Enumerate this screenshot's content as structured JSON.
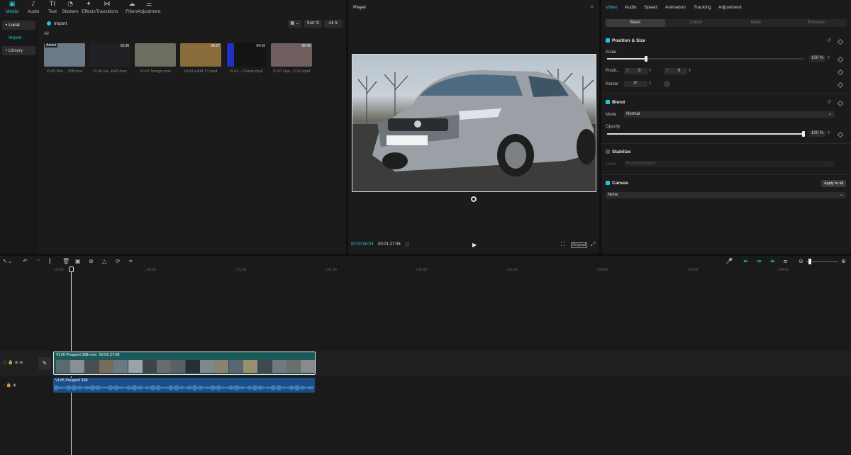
{
  "toolbar": {
    "items": [
      {
        "label": "Media",
        "icon": "media-icon",
        "glyph": "▣",
        "active": true
      },
      {
        "label": "Audio",
        "icon": "audio-icon",
        "glyph": "♪"
      },
      {
        "label": "Text",
        "icon": "text-icon",
        "glyph": "TI"
      },
      {
        "label": "Stickers",
        "icon": "sticker-icon",
        "glyph": "◔"
      },
      {
        "label": "Effects",
        "icon": "effects-icon",
        "glyph": "✦"
      },
      {
        "label": "Transitions",
        "icon": "transitions-icon",
        "glyph": "⋈"
      },
      {
        "label": "Filters",
        "icon": "filters-icon",
        "glyph": "☁"
      },
      {
        "label": "Adjustment",
        "icon": "adjustment-icon",
        "glyph": "⚌"
      }
    ]
  },
  "sidebar": {
    "local": "• Local",
    "import": "Import",
    "library": "• Library"
  },
  "media": {
    "import_label": "Import",
    "all_label": "All",
    "sort_label": "Sort",
    "filter_all": "All",
    "thumbs": [
      {
        "name": "VL#5 Peu... 308.mov",
        "duration": "",
        "badge": "Added",
        "color": "#6b7a86"
      },
      {
        "name": "VL#6 Ea...RAT.mov",
        "duration": "10:36",
        "color": "#1f2124"
      },
      {
        "name": "VL#4 Twingo.mov",
        "duration": "",
        "color": "#6a6f60"
      },
      {
        "name": "VL#3 e208 YT.mp4",
        "duration": "06:27",
        "color": "#8a6b3a"
      },
      {
        "name": "VL#1 – Conse.mp4",
        "duration": "04:10",
        "color": "#141414"
      },
      {
        "name": "VL#7 Hyu...0 V2.mp4",
        "duration": "06:49",
        "color": "#6f5f5f"
      }
    ]
  },
  "player": {
    "title": "Player",
    "current": "00:00:06:04",
    "total": "00:01:27:06",
    "ratio": "Original"
  },
  "inspector": {
    "tabs": [
      "Video",
      "Audio",
      "Speed",
      "Animation",
      "Tracking",
      "Adjustment"
    ],
    "subtabs": [
      "Basic",
      "Cutout",
      "Mask",
      "Enhance"
    ],
    "position_size": "Position & Size",
    "scale_label": "Scale",
    "scale_value": "100 %",
    "scale_level": 0.2,
    "position_label": "Positi...",
    "x_label": "X",
    "x_value": "0",
    "y_label": "Y",
    "y_value": "0",
    "rotate_label": "Rotate",
    "rotate_value": "0°",
    "blend": "Blend",
    "mode_label": "Mode",
    "mode_value": "Normal",
    "opacity_label": "Opacity",
    "opacity_value": "100 %",
    "opacity_level": 1.0,
    "stabilize": "Stabilize",
    "level_label": "Level",
    "level_value": "Recommended",
    "canvas": "Canvas",
    "apply_all": "Apply to all",
    "canvas_value": "None"
  },
  "timeline": {
    "ticks": [
      "00:00",
      "00:30",
      "01:00",
      "01:30",
      "02:00",
      "02:30",
      "03:00",
      "03:30",
      "04:00"
    ],
    "video_clip_label": "VL#5 Peugeot 308.mov",
    "video_clip_duration": "00:01:27:06",
    "audio_clip_label": "VL#5 Peugeot 308"
  },
  "colors": {
    "accent": "#1fc8d8",
    "clip_bg": "#1c5a5a",
    "audio_bg": "#1a4e8a"
  }
}
